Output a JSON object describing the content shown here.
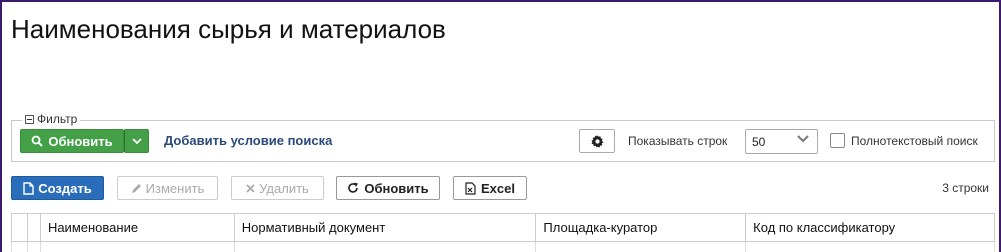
{
  "page": {
    "title": "Наименования сырья и материалов"
  },
  "filter": {
    "legend": "Фильтр",
    "refresh_label": "Обновить",
    "add_condition_label": "Добавить условие поиска",
    "rows_label": "Показывать строк",
    "rows_value": "50",
    "fulltext_label": "Полнотекстовый поиск",
    "fulltext_checked": false
  },
  "toolbar": {
    "create_label": "Создать",
    "edit_label": "Изменить",
    "delete_label": "Удалить",
    "refresh_label": "Обновить",
    "excel_label": "Excel",
    "rows_count": "3 строки"
  },
  "table": {
    "columns": [
      "Наименование",
      "Нормативный документ",
      "Площадка-куратор",
      "Код по классификатору"
    ]
  },
  "colors": {
    "primary": "#2a6ebb",
    "success": "#43a047",
    "frame": "#3d1a6b"
  }
}
